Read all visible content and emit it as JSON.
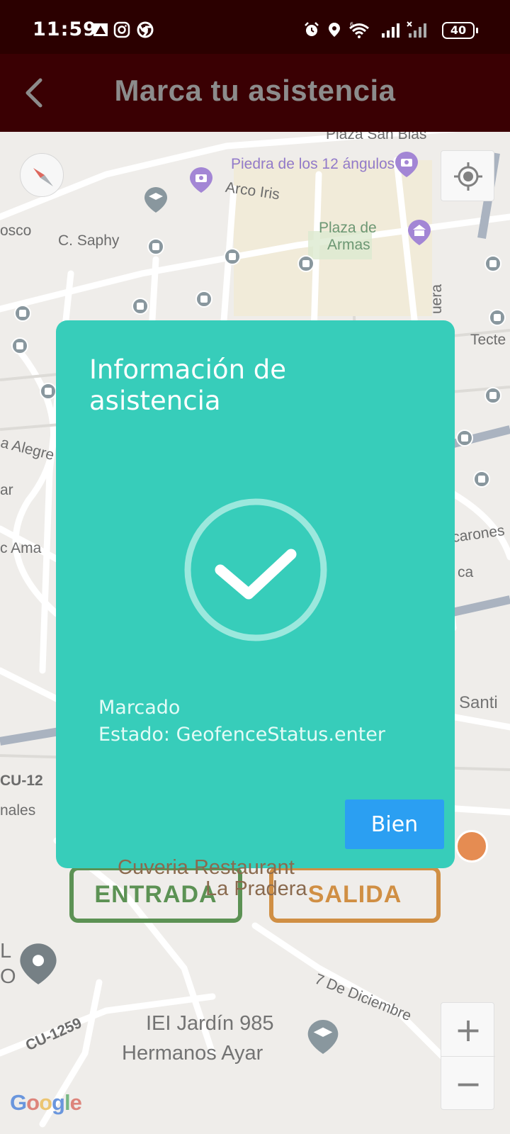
{
  "status_bar": {
    "time": "11:59",
    "battery": "40",
    "icons": [
      "navigation-arrow-icon",
      "instagram-icon",
      "chrome-icon",
      "alarm-icon",
      "location-icon",
      "wifi-icon",
      "signal-icon",
      "signal-muted-icon",
      "battery-icon"
    ]
  },
  "app_bar": {
    "title": "Marca tu asistencia",
    "background": "#3a0003"
  },
  "map": {
    "labels": [
      "Plaza San Blas",
      "Piedra de los 12 ángulos",
      "Arco Iris",
      "osco",
      "C. Saphy",
      "Plaza de",
      "Armas",
      "uera",
      "Tecte",
      "a Alegre",
      "ar",
      "c Ama",
      "carones",
      "ca",
      "Santi",
      "CU-12",
      "nales",
      "Cuveria Restaurant",
      "La Pradera",
      "7 De Diciembre",
      "CU-1259",
      "IEI Jardín 985",
      "Hermanos Ayar",
      "L",
      "O"
    ],
    "entrada_label": "ENTRADA",
    "salida_label": "SALIDA",
    "zoom_in": "+",
    "zoom_out": "−",
    "google": [
      "G",
      "o",
      "o",
      "g",
      "l",
      "e"
    ]
  },
  "dialog": {
    "title": "Información de asistencia",
    "status_line1": "Marcado",
    "status_line2": "Estado: GeofenceStatus.enter",
    "button_label": "Bien",
    "background": "#37cdba",
    "button_color": "#2b9ff2"
  }
}
